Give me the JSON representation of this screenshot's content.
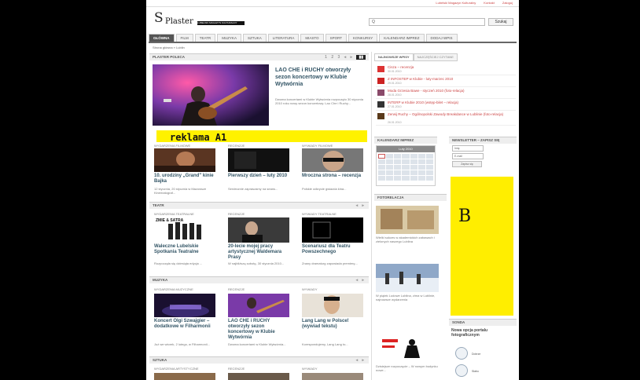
{
  "header": {
    "logo_symbol": "S",
    "logo_name": "Plaster",
    "tagline": "LUBELSKI MAGAZYN KULTURALNY",
    "search_placeholder": "Q",
    "search_button": "Szukaj",
    "top_links": [
      "Lubelski Magazyn Kulturalny",
      "Kontakt",
      "Zaloguj"
    ]
  },
  "nav": {
    "tabs": [
      "GŁÓWNA",
      "FILM",
      "TEATR",
      "MUZYKA",
      "SZTUKA",
      "LITERATURA",
      "MIASTO",
      "SPORT",
      "KONKURSY",
      "KALENDARZ IMPREZ",
      "DODAJ WPIS"
    ]
  },
  "breadcrumb": "Strona główna » Lublin",
  "featured": {
    "section": "PLASTER POLECA",
    "title": "LAO CHE i RUCHY otworzyły sezon koncertowy w Klubie Wytwórnia",
    "excerpt": "Dwoma koncertami w Klubie Wytwórnia rozpoczęto 30 stycznia 2010 roku nowy sezon koncertowy. Lao Che i Ruchy...",
    "pager": "1 2 3"
  },
  "ad_a": "reklama A1",
  "ad_b": "B",
  "film": {
    "cats": [
      "WYDARZENIA FILMOWE",
      "RECENZJE",
      "WYWIADY FILMOWE"
    ],
    "items": [
      {
        "title": "10. urodziny „Grand\" kinie Bajka",
        "text": "12 stycznia, 20 stycznia w Mazowsze Kinematograf..."
      },
      {
        "title": "Pierwszy dzień – luty 2010",
        "text": "Serdecznie zapraszamy na seans..."
      },
      {
        "title": "Mroczna strona – recenzja",
        "text": "Polskie odkrycie gwiazda kina..."
      }
    ]
  },
  "theatre": {
    "section": "TEATR",
    "cats": [
      "WYDARZENIA TEATRALNE",
      "RECENZJE",
      "WYWIADY TEATRALNE"
    ],
    "items": [
      {
        "title": "Waleczne Lubelskie Spotkania Teatralne",
        "text": "Rozpoczęła się dziesiąta edycja ..."
      },
      {
        "title": "20-lecie mojej pracy artystycznej Waldemara Prasy",
        "text": "W najbliższą sobotę, 30 stycznia 2010..."
      },
      {
        "title": "Scenariusz dla Teatru Powszechnego",
        "text": "Znany dramaturg zapowiada premierę..."
      }
    ],
    "poster_text": "ZMIE & SATRA"
  },
  "music": {
    "section": "MUZYKA",
    "cats": [
      "WYDARZENIA MUZYCZNE",
      "RECENZJE",
      "WYWIADY"
    ],
    "items": [
      {
        "title": "Koncert Olgi Szwajgier – dodatkowe w Filharmonii",
        "text": "Już we wtorek, 2 lutego, w Filharmonii..."
      },
      {
        "title": "LAO CHE i RUCHY otworzyły sezon koncertowy w Klubie Wytwórnia",
        "text": "Dwoma koncertami w Klubie Wytwórnia..."
      },
      {
        "title": "Lang Lang w Polsce! (wywiad tekstu)",
        "text": "Korespondujemy, Lang Lang to..."
      }
    ]
  },
  "art": {
    "section": "SZTUKA",
    "cats": [
      "WYDARZENIA ARTYSTYCZNE",
      "RECENZJE",
      "WYWIADY"
    ]
  },
  "sidebar": {
    "tabs": [
      "NAJNOWSZE WPISY",
      "NAJCZĘŚCIEJ CZYTANE"
    ],
    "news": [
      {
        "title": "Cisza – recenzja",
        "date": "30.01.2010"
      },
      {
        "title": "Z INFOSTEP w Klubie - luty-marzec 2010",
        "date": "29.01.2010"
      },
      {
        "title": "Moda Grzesia Bawe - styczeń 2010 (foto-relacja)",
        "date": "28.01.2010"
      },
      {
        "title": "INTERP w Klubie 2010 (wstęp-bilet – relacja)",
        "date": "27.01.2010"
      },
      {
        "title": "Zerwij Ruchy – Ogólnopolski Zawody Breakdance w Lublinie (foto-relacja)",
        "date": "26.01.2010"
      }
    ],
    "calendar": {
      "title": "KALENDARZ IMPREZ",
      "month": "Luty 2010"
    },
    "newsletter": {
      "title": "NEWSLETTER – ZAPISZ SIĘ",
      "name_placeholder": "Imię",
      "email_placeholder": "E-mail",
      "button": "Zapisz się"
    },
    "photo": {
      "title": "FOTORELACJA",
      "caption1": "Wielki sukces w akademickich zabawach i zielonych naszego Lublina",
      "caption2": "W piątek Ludowe Lublina, zima w Lublinie, najnowsze wydarzenia",
      "caption3": "Dzisiejsze rozpoczęcie – W nowym budynku nowe..."
    },
    "poll": {
      "title": "SONDA",
      "question": "Nowa opcja portalu fotograficznym",
      "options": [
        "Dobrze",
        "Słabo"
      ]
    }
  },
  "colors": {
    "accent": "#c44444",
    "ad_yellow": "#fff200",
    "nav_active": "#555555"
  }
}
